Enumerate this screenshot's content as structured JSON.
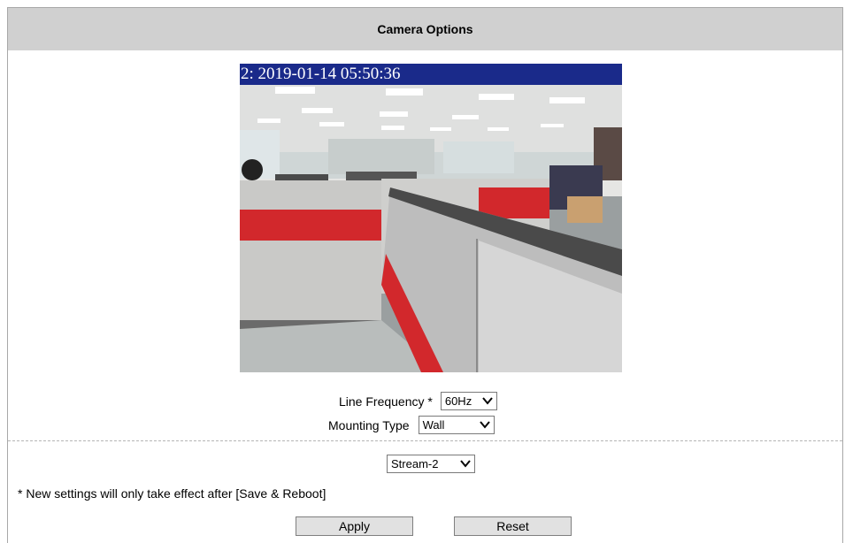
{
  "header": {
    "title": "Camera Options"
  },
  "preview": {
    "osd_text": "2: 2019-01-14 05:50:36"
  },
  "settings": {
    "line_frequency": {
      "label": "Line Frequency *",
      "value": "60Hz"
    },
    "mounting_type": {
      "label": "Mounting Type",
      "value": "Wall"
    }
  },
  "stream": {
    "value": "Stream-2"
  },
  "note": "* New settings will only take effect after [Save & Reboot]",
  "buttons": {
    "apply": "Apply",
    "reset": "Reset"
  }
}
